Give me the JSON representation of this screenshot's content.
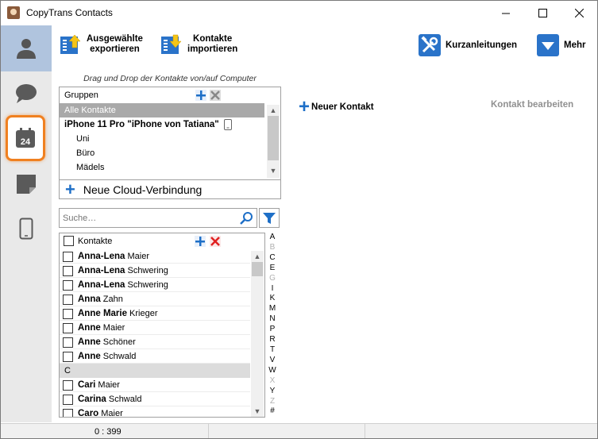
{
  "window": {
    "title": "CopyTrans Contacts",
    "minimize": "—",
    "maximize": "☐",
    "close": "✕"
  },
  "sidebar": {
    "items": [
      {
        "name": "contacts",
        "icon": "person-icon",
        "active": true
      },
      {
        "name": "messages",
        "icon": "speech-bubble-icon"
      },
      {
        "name": "calendar",
        "icon": "calendar-icon",
        "label": "24",
        "highlighted": true
      },
      {
        "name": "notes",
        "icon": "note-icon"
      },
      {
        "name": "device",
        "icon": "phone-icon"
      }
    ]
  },
  "toolbar": {
    "export_label_1": "Ausgewählte",
    "export_label_2": "exportieren",
    "import_label_1": "Kontakte",
    "import_label_2": "importieren",
    "guides_label": "Kurzanleitungen",
    "more_label": "Mehr"
  },
  "groups": {
    "drag_hint": "Drag und Drop der Kontakte von/auf Computer",
    "header": "Gruppen",
    "rows": [
      {
        "label": "Alle Kontakte"
      },
      {
        "label": "iPhone 11 Pro \"iPhone von Tatiana\""
      },
      {
        "label": "Uni"
      },
      {
        "label": "Büro"
      },
      {
        "label": "Mädels"
      }
    ],
    "cloud_label": "Neue Cloud-Verbindung"
  },
  "search": {
    "placeholder": "Suche…"
  },
  "contacts": {
    "header": "Kontakte",
    "rows": [
      {
        "first": "Anna-Lena",
        "last": " Maier"
      },
      {
        "first": "Anna-Lena",
        "last": " Schwering"
      },
      {
        "first": "Anna-Lena",
        "last": " Schwering"
      },
      {
        "first": "Anna",
        "last": " Zahn"
      },
      {
        "first": "Anne Marie",
        "last": " Krieger"
      },
      {
        "first": "Anne",
        "last": " Maier"
      },
      {
        "first": "Anne",
        "last": " Schöner"
      },
      {
        "first": "Anne",
        "last": " Schwald"
      }
    ],
    "section": "C",
    "rows_c": [
      {
        "first": "Cari",
        "last": " Maier"
      },
      {
        "first": "Carina",
        "last": " Schwald"
      },
      {
        "first": "Caro",
        "last": " Maier"
      }
    ]
  },
  "alphabet": [
    "A",
    "B",
    "C",
    "E",
    "G",
    "I",
    "K",
    "M",
    "N",
    "P",
    "R",
    "T",
    "V",
    "W",
    "X",
    "Y",
    "Z",
    "#"
  ],
  "alphabet_dim": [
    "B",
    "G",
    "X",
    "Z"
  ],
  "right": {
    "new_contact": "Neuer Kontakt",
    "edit_contact": "Kontakt bearbeiten"
  },
  "status": {
    "count": "0 : 399"
  }
}
